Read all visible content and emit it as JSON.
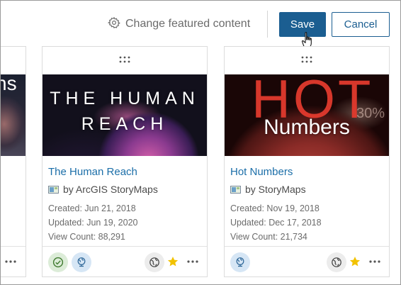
{
  "toolbar": {
    "change_featured_label": "Change featured content",
    "save_label": "Save",
    "cancel_label": "Cancel"
  },
  "colors": {
    "primary": "#1b5e91",
    "link": "#1b6ea8",
    "star": "#f2c200",
    "badge_green": "#dcecd8",
    "badge_blue": "#d6e6f5"
  },
  "partial_card": {
    "thumbnail_text": "ns"
  },
  "cards": [
    {
      "thumbnail_line1": "THE HUMAN",
      "thumbnail_line2": "REACH",
      "title": "The Human Reach",
      "author": "by ArcGIS StoryMaps",
      "created": "Created: Jun 21, 2018",
      "updated": "Updated: Jun 19, 2020",
      "view_count": "View Count: 88,291",
      "badges": [
        "authoritative-check-icon",
        "shared-globe-icon"
      ],
      "public_icon": "world-icon",
      "favorite": true
    },
    {
      "thumbnail_line1": "HOT",
      "thumbnail_line2": "Numbers",
      "thumbnail_extra": "30%",
      "title": "Hot Numbers",
      "author": "by StoryMaps",
      "created": "Created: Nov 19, 2018",
      "updated": "Updated: Dec 17, 2018",
      "view_count": "View Count: 21,734",
      "badges": [
        "shared-globe-icon"
      ],
      "public_icon": "world-icon",
      "favorite": true
    }
  ]
}
